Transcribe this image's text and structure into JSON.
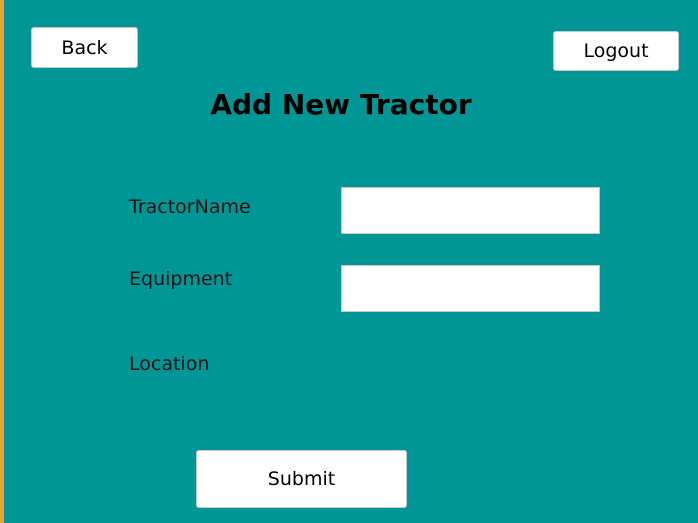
{
  "nav": {
    "back_label": "Back",
    "logout_label": "Logout"
  },
  "form": {
    "title": "Add New Tractor",
    "fields": [
      {
        "label": "TractorName",
        "value": "",
        "placeholder": ""
      },
      {
        "label": "Equipment",
        "value": "",
        "placeholder": ""
      },
      {
        "label": "Location"
      }
    ],
    "submit_label": "Submit"
  },
  "colors": {
    "background": "#009696",
    "left_accent": "#e8a33a",
    "button_bg": "#ffffff"
  }
}
